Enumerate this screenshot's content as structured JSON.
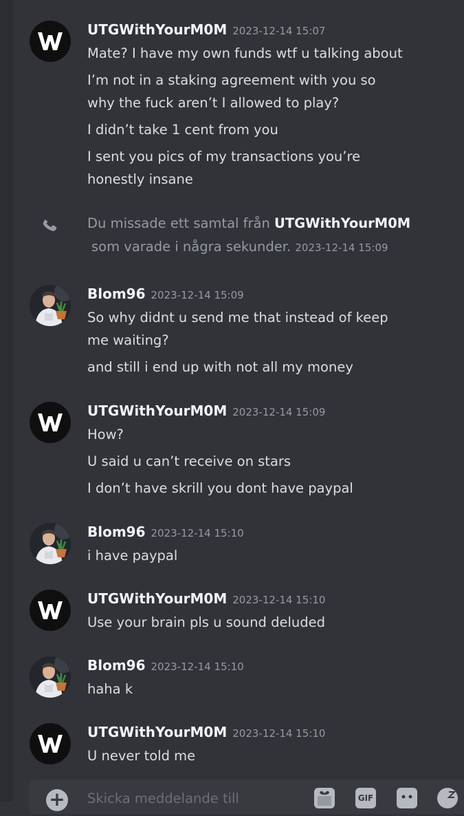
{
  "messages": [
    {
      "author": "UTGWithYourM0M",
      "timestamp": "2023-12-14 15:07",
      "lines": [
        "Mate? I have my own funds wtf u talking about",
        "I’m not in a staking agreement with you so",
        "why the fuck aren’t I allowed to play?",
        "I didn’t take 1 cent from you",
        "I sent you pics of my transactions you’re",
        "honestly insane"
      ]
    },
    {
      "author": "Blom96",
      "timestamp": "2023-12-14 15:09",
      "lines": [
        "So why didnt u send me that instead of keep",
        "me waiting?",
        "and still  i end up with not all my money"
      ]
    },
    {
      "author": "UTGWithYourM0M",
      "timestamp": "2023-12-14 15:09",
      "lines": [
        "How?",
        "U said u can’t  receive on stars",
        "I don’t have skrill you dont have paypal"
      ]
    },
    {
      "author": "Blom96",
      "timestamp": "2023-12-14 15:10",
      "lines": [
        "i have paypal"
      ]
    },
    {
      "author": "UTGWithYourM0M",
      "timestamp": "2023-12-14 15:10",
      "lines": [
        "Use your brain pls u sound deluded"
      ]
    },
    {
      "author": "Blom96",
      "timestamp": "2023-12-14 15:10",
      "lines": [
        "haha k"
      ]
    },
    {
      "author": "UTGWithYourM0M",
      "timestamp": "2023-12-14 15:10",
      "lines": [
        "U never told me"
      ]
    }
  ],
  "missed_call": {
    "prefix": "Du missade ett samtal från",
    "caller": "UTGWithYourM0M",
    "suffix": "som varade i några sekunder.",
    "timestamp": "2023-12-14 15:09"
  },
  "composer": {
    "placeholder": "Skicka meddelande till",
    "gif_label": "GIF"
  },
  "colors": {
    "background": "#313338",
    "sidebar": "#2b2d31",
    "username": "#f2f3f5",
    "timestamp": "#949ba4",
    "text": "#dbdee1"
  },
  "icons": [
    "phone-missed-icon",
    "plus-icon",
    "gift-icon",
    "gif-icon",
    "sticker-icon",
    "emoji-icon"
  ]
}
